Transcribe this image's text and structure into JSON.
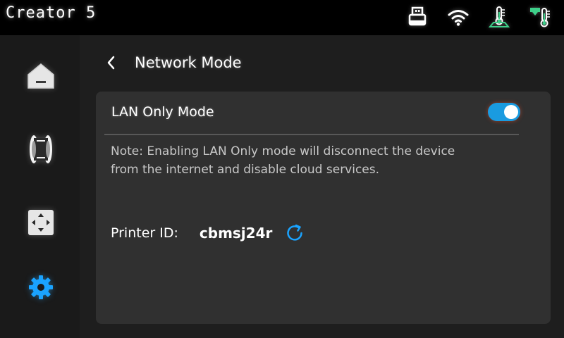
{
  "app": {
    "title": "Creator 5"
  },
  "status_bar": {
    "icons": [
      "usb-icon",
      "wifi-icon",
      "bed-temperature-icon",
      "nozzle-temperature-icon"
    ],
    "accent_color": "#3ed08a"
  },
  "sidebar": {
    "items": [
      {
        "name": "home",
        "icon": "home-icon"
      },
      {
        "name": "filament",
        "icon": "filament-spool-icon"
      },
      {
        "name": "move",
        "icon": "move-axes-icon"
      },
      {
        "name": "settings",
        "icon": "gear-icon",
        "active": true
      }
    ],
    "active_color": "#1aa3ff"
  },
  "page": {
    "title": "Network Mode",
    "back_icon": "chevron-left-icon"
  },
  "lan_mode": {
    "label": "LAN Only Mode",
    "enabled": true,
    "note_line1": "Note: Enabling LAN Only mode will disconnect the device",
    "note_line2": "from the internet and disable cloud services."
  },
  "printer": {
    "id_label": "Printer ID:",
    "id_value": "cbmsj24r",
    "refresh_icon": "refresh-icon"
  },
  "colors": {
    "toggle_on": "#1a9be0",
    "card_bg": "#303030",
    "page_bg": "#1e1e1e"
  }
}
